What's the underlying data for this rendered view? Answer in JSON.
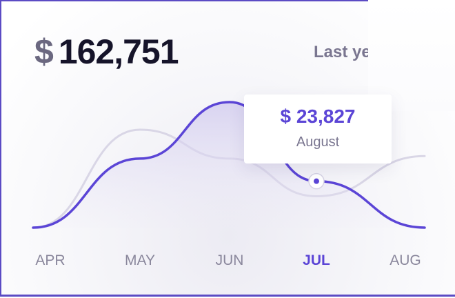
{
  "summary": {
    "currency": "$",
    "total": "162,751",
    "period_label": "Last ye"
  },
  "tooltip": {
    "value": "$ 23,827",
    "label": "August"
  },
  "colors": {
    "primary": "#5b45d6",
    "secondary": "#d9d6e6",
    "text_dark": "#16142a",
    "text_muted": "#7a7690",
    "border": "#5b4bc4"
  },
  "chart_data": {
    "type": "line",
    "categories": [
      "APR",
      "MAY",
      "JUN",
      "JUL",
      "AUG"
    ],
    "active_category": "JUL",
    "series": [
      {
        "values": [
          0,
          0.55,
          1.0,
          0.37,
          0.0
        ],
        "style": "area"
      },
      {
        "values": [
          0,
          0.78,
          0.55,
          0.25,
          0.57
        ],
        "style": "line"
      }
    ],
    "highlight": {
      "category": "JUL",
      "series_index": 0
    },
    "grid": false,
    "legend": "none"
  }
}
